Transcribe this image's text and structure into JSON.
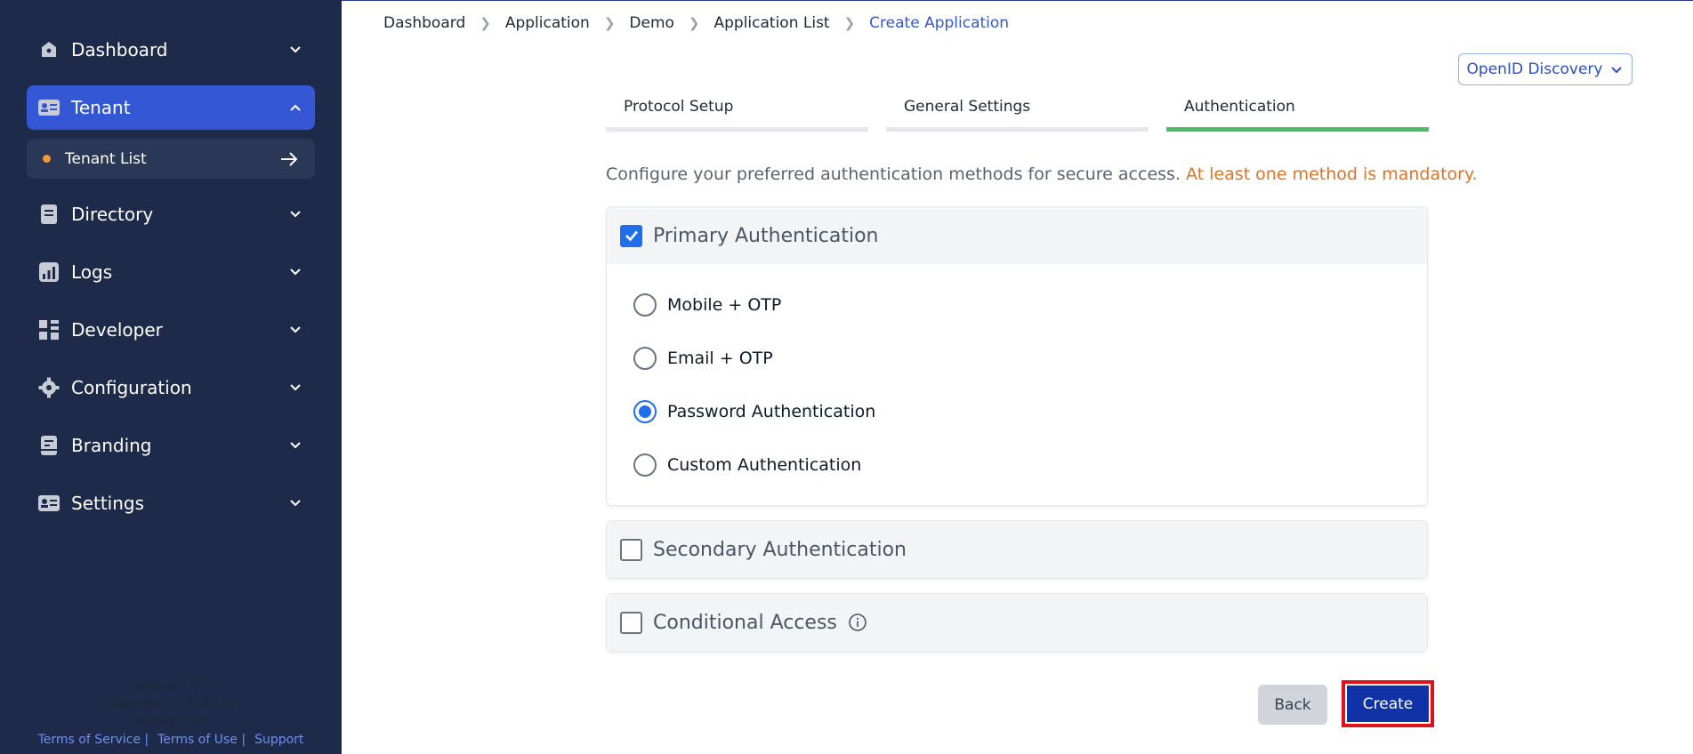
{
  "sidebar": {
    "items": [
      {
        "label": "Dashboard",
        "icon": "home-icon"
      },
      {
        "label": "Tenant",
        "icon": "id-card-icon",
        "active": true
      },
      {
        "label": "Directory",
        "icon": "book-icon"
      },
      {
        "label": "Logs",
        "icon": "chart-icon"
      },
      {
        "label": "Developer",
        "icon": "grid-icon"
      },
      {
        "label": "Configuration",
        "icon": "gear-icon"
      },
      {
        "label": "Branding",
        "icon": "brand-icon"
      },
      {
        "label": "Settings",
        "icon": "id-card-icon"
      }
    ],
    "sub_item": {
      "label": "Tenant List"
    },
    "footer": {
      "version": "Version 3.0.3",
      "copyright": "Copyright © 2025 by",
      "company": "Infisign Inc",
      "links": [
        "Terms of Service |",
        "Terms of Use |",
        "Support"
      ]
    }
  },
  "breadcrumb": [
    "Dashboard",
    "Application",
    "Demo",
    "Application List",
    "Create Application"
  ],
  "discovery_button": {
    "label": "OpenID Discovery"
  },
  "tabs": [
    "Protocol Setup",
    "General Settings",
    "Authentication"
  ],
  "intro": {
    "text": "Configure your preferred authentication methods for secure access.",
    "warning": "At least one method is mandatory."
  },
  "primary": {
    "title": "Primary Authentication",
    "checked": true,
    "options": [
      "Mobile + OTP",
      "Email + OTP",
      "Password Authentication",
      "Custom Authentication"
    ],
    "selected": "Password Authentication"
  },
  "secondary": {
    "title": "Secondary Authentication",
    "checked": false
  },
  "conditional": {
    "title": "Conditional Access",
    "checked": false
  },
  "actions": {
    "back": "Back",
    "create": "Create"
  },
  "colors": {
    "sidebar_bg": "#1e2a4a",
    "active_nav": "#3457d5",
    "tab_active": "#4cba6a",
    "warning_text": "#d9742a",
    "primary_button": "#1031a8",
    "highlight_outline": "#e0121b"
  }
}
